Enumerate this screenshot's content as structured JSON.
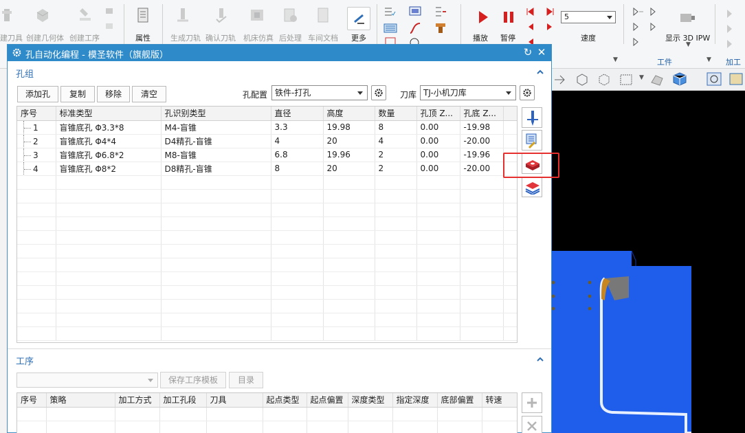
{
  "ribbon": {
    "items": [
      "建刀具",
      "创建几何体",
      "创建工序",
      "属性",
      "生成刀轨",
      "确认刀轨",
      "机床仿真",
      "后处理",
      "车间文档",
      "更多"
    ],
    "play_label": "播放",
    "pause_label": "暂停",
    "speed_value": "5",
    "speed_label": "速度",
    "show_ipw_label": "显示 3D IPW",
    "workpiece_label": "工件",
    "machining_label": "加工工"
  },
  "dialog": {
    "title": "孔自动化编程 - 模圣软件（旗舰版）",
    "hole_group": {
      "section_title": "孔组",
      "buttons": {
        "add": "添加孔",
        "copy": "复制",
        "remove": "移除",
        "clear": "清空"
      },
      "config_label": "孔配置",
      "config_value": "铁件-打孔",
      "library_label": "刀库",
      "library_value": "TJ-小机刀库",
      "columns": [
        "序号",
        "标准类型",
        "孔识别类型",
        "直径",
        "高度",
        "数量",
        "孔顶 Z...",
        "孔底 Z..."
      ],
      "rows": [
        [
          "1",
          "盲锥底孔 Φ3.3*8",
          "M4-盲锥",
          "3.3",
          "19.98",
          "8",
          "0.00",
          "-19.98"
        ],
        [
          "2",
          "盲锥底孔 Φ4*4",
          "D4精孔-盲锥",
          "4",
          "20",
          "4",
          "0.00",
          "-20.00"
        ],
        [
          "3",
          "盲锥底孔 Φ6.8*2",
          "M8-盲锥",
          "6.8",
          "19.96",
          "2",
          "0.00",
          "-19.96"
        ],
        [
          "4",
          "盲锥底孔 Φ8*2",
          "D8精孔-盲锥",
          "8",
          "20",
          "2",
          "0.00",
          "-20.00"
        ]
      ]
    },
    "operation": {
      "section_title": "工序",
      "save_template_label": "保存工序模板",
      "catalog_label": "目录",
      "columns": [
        "序号",
        "策略",
        "加工方式",
        "加工孔段",
        "刀具",
        "起点类型",
        "起点偏置",
        "深度类型",
        "指定深度",
        "底部偏置",
        "转速"
      ]
    }
  },
  "colors": {
    "accent": "#2e8ac9",
    "section": "#2f6fb5",
    "highlight": "#e52e2e",
    "model": "#1e5eea"
  }
}
